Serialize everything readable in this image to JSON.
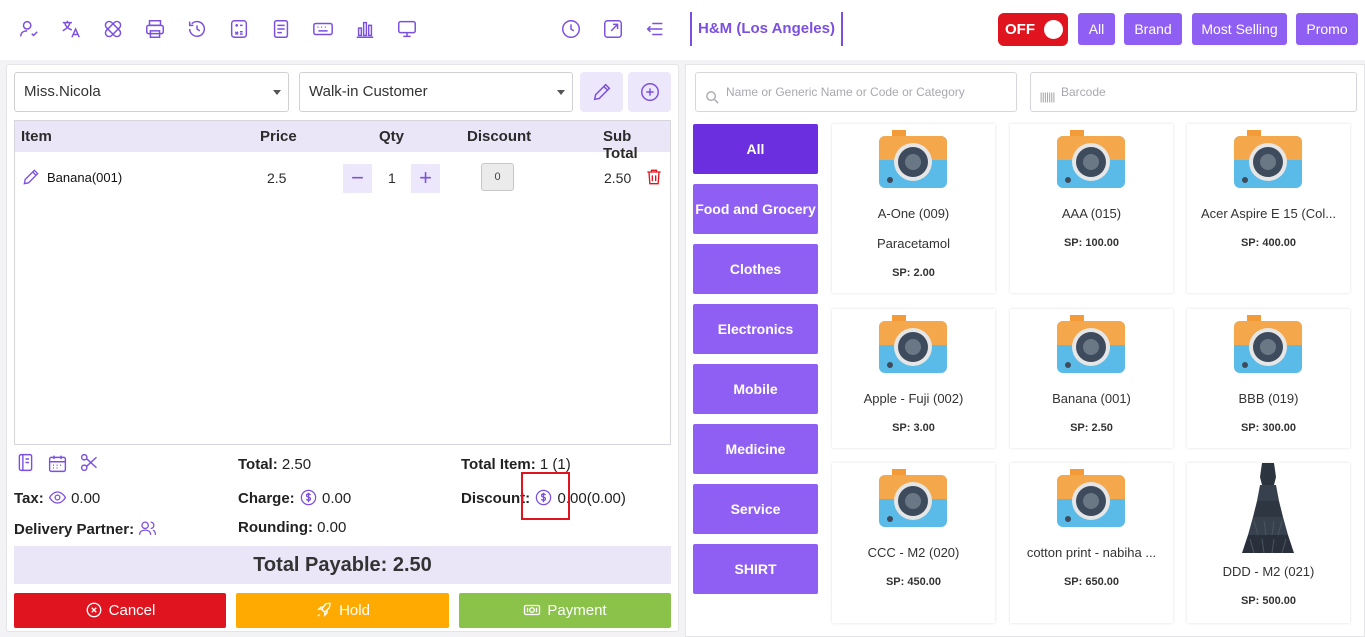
{
  "topbar": {
    "left_icons": [
      "user-icon",
      "translate-icon",
      "bandage-icon",
      "printer-icon",
      "history-icon",
      "calculator-icon",
      "document-icon",
      "keyboard-icon",
      "chart-bar-icon",
      "monitor-icon"
    ],
    "right_icons": [
      "clock-icon",
      "fullscreen-icon",
      "collapse-menu-icon"
    ],
    "store_name": "H&M (Los Angeles)",
    "toggle_label": "OFF",
    "filter_buttons": [
      "All",
      "Brand",
      "Most Selling",
      "Promo"
    ]
  },
  "order": {
    "waiter": "Miss.Nicola",
    "customer": "Walk-in Customer",
    "columns": {
      "item": "Item",
      "price": "Price",
      "qty": "Qty",
      "discount": "Discount",
      "subtotal": "Sub Total"
    },
    "items": [
      {
        "name": "Banana(001)",
        "price": "2.5",
        "qty": "1",
        "discount": "0",
        "subtotal": "2.50"
      }
    ]
  },
  "summary": {
    "total_label": "Total:",
    "total_value": "2.50",
    "total_item_label": "Total Item:",
    "total_item_value": "1 (1)",
    "tax_label": "Tax:",
    "tax_value": "0.00",
    "charge_label": "Charge:",
    "charge_value": "0.00",
    "discount_label": "Discount:",
    "discount_value": "0.00(0.00)",
    "delivery_label": "Delivery Partner:",
    "rounding_label": "Rounding:",
    "rounding_value": "0.00",
    "payable_label": "Total Payable: 2.50"
  },
  "actions": {
    "cancel": "Cancel",
    "hold": "Hold",
    "payment": "Payment"
  },
  "search": {
    "placeholder": "Name or Generic Name or Code or Category",
    "barcode_placeholder": "Barcode"
  },
  "categories": [
    "All",
    "Food and Grocery",
    "Clothes",
    "Electronics",
    "Mobile",
    "Medicine",
    "Service",
    "SHIRT"
  ],
  "products": [
    {
      "name": "A-One (009)",
      "generic": "Paracetamol",
      "price": "SP: 2.00",
      "image": "camera-icon"
    },
    {
      "name": "AAA (015)",
      "generic": "",
      "price": "SP: 100.00",
      "image": "camera-icon"
    },
    {
      "name": "Acer Aspire E 15 (Col...",
      "generic": "",
      "price": "SP: 400.00",
      "image": "camera-icon"
    },
    {
      "name": "Apple - Fuji (002)",
      "generic": "",
      "price": "SP: 3.00",
      "image": "camera-icon"
    },
    {
      "name": "Banana (001)",
      "generic": "",
      "price": "SP: 2.50",
      "image": "camera-icon"
    },
    {
      "name": "BBB (019)",
      "generic": "",
      "price": "SP: 300.00",
      "image": "camera-icon"
    },
    {
      "name": "CCC - M2 (020)",
      "generic": "",
      "price": "SP: 450.00",
      "image": "camera-icon"
    },
    {
      "name": "cotton print - nabiha ...",
      "generic": "",
      "price": "SP: 650.00",
      "image": "camera-icon"
    },
    {
      "name": "DDD - M2 (021)",
      "generic": "",
      "price": "SP: 500.00",
      "image": "dress-photo"
    }
  ],
  "colors": {
    "accent": "#8f5ef2",
    "accent_dark": "#6b2fe0",
    "cancel": "#e0141e",
    "hold": "#ffaa00",
    "payment": "#8bc34a",
    "toggle_off": "#e0141e"
  }
}
